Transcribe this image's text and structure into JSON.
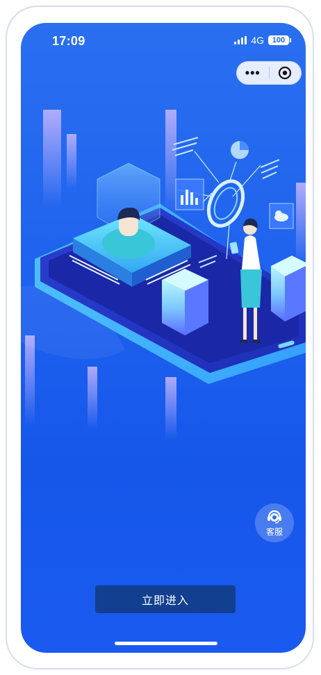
{
  "status_bar": {
    "time": "17:09",
    "network": "4G",
    "battery": "100"
  },
  "capsule": {
    "more_label": "•••",
    "more_icon": "more-dots-icon",
    "close_icon": "target-circle-icon"
  },
  "service": {
    "label": "客服",
    "icon": "headset-icon"
  },
  "enter_button": {
    "label": "立即进入"
  },
  "colors": {
    "background_top": "#2a6ff0",
    "background_bottom": "#1657ea",
    "button": "#123f8f",
    "text": "#ffffff"
  }
}
